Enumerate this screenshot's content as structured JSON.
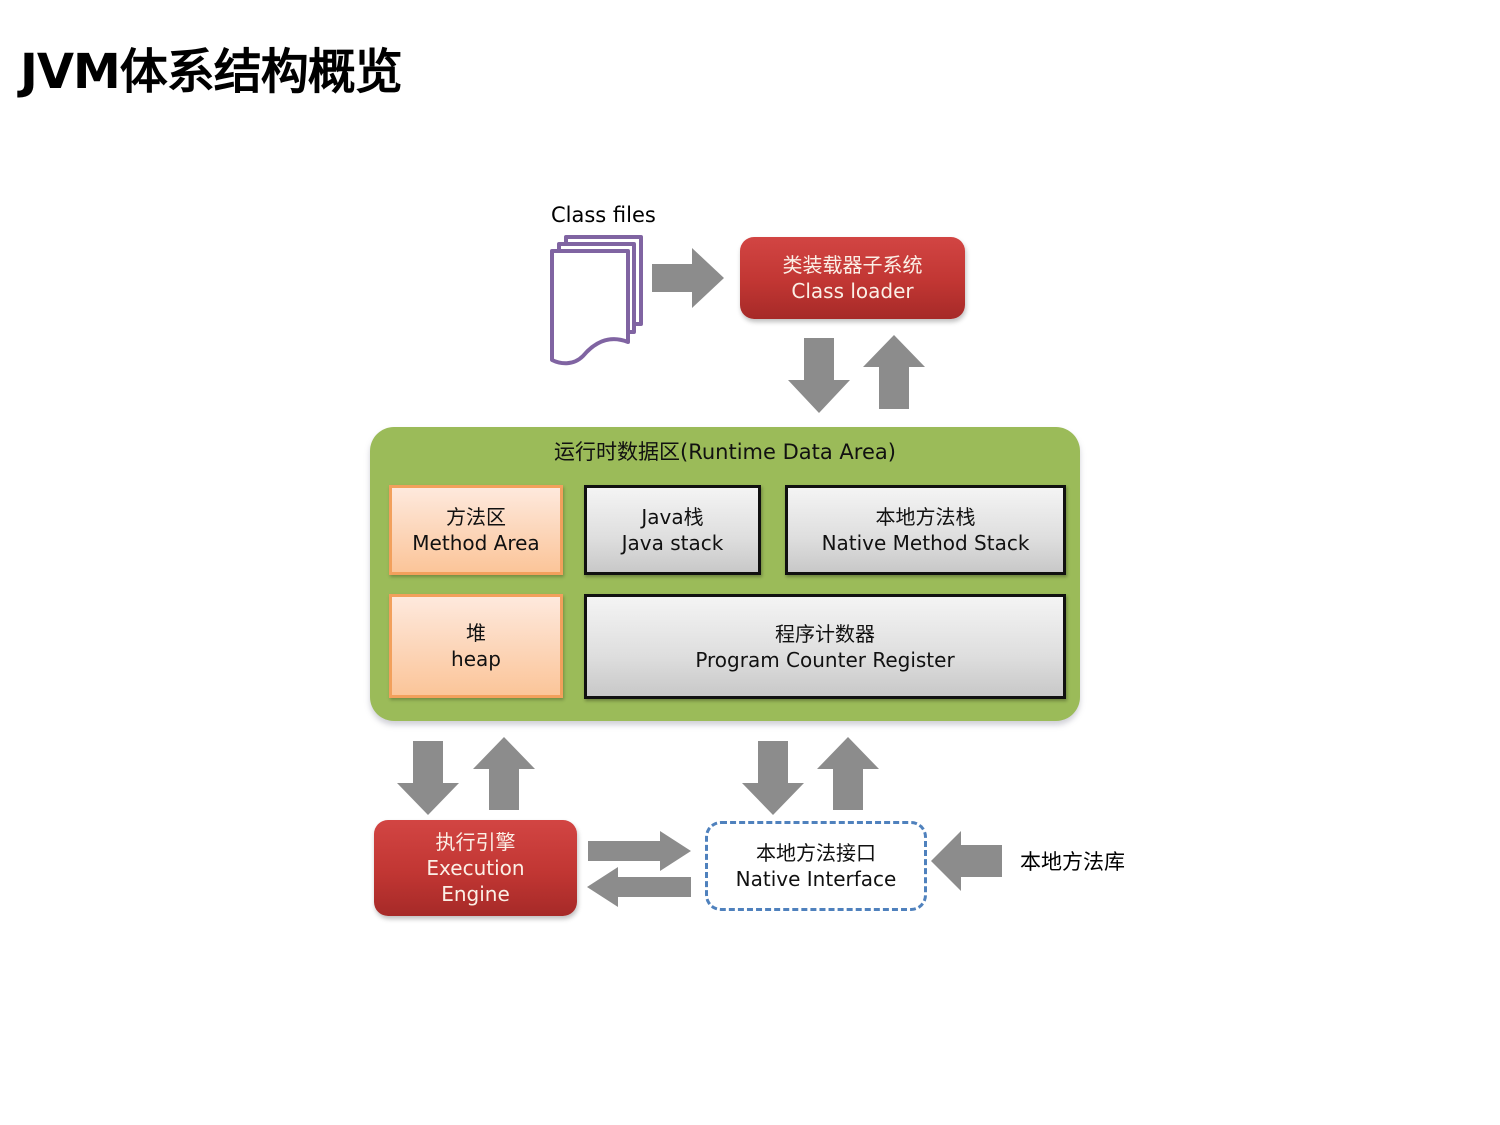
{
  "title": "JVM体系结构概览",
  "class_files": {
    "label": "Class files",
    "icon": "stacked-documents-icon",
    "icon_color": "#8064a2"
  },
  "class_loader": {
    "line1": "类装载器子系统",
    "line2": "Class loader"
  },
  "runtime_data_area": {
    "title": "运行时数据区(Runtime Data Area)",
    "color": "#9bbb59",
    "method_area": {
      "line1": "方法区",
      "line2": "Method Area"
    },
    "java_stack": {
      "line1": "Java栈",
      "line2": "Java stack"
    },
    "native_method_stack": {
      "line1": "本地方法栈",
      "line2": "Native Method Stack"
    },
    "heap": {
      "line1": "堆",
      "line2": "heap"
    },
    "program_counter": {
      "line1": "程序计数器",
      "line2": "Program Counter Register"
    }
  },
  "execution_engine": {
    "line1": "执行引擎",
    "line2": "Execution",
    "line3": "Engine"
  },
  "native_interface": {
    "line1": "本地方法接口",
    "line2": "Native Interface",
    "border_color": "#4f81bd"
  },
  "native_library": {
    "label": "本地方法库"
  },
  "colors": {
    "red_box": "#c0392b",
    "orange_box": "#fcd3b4",
    "gray_box": "#dedede",
    "arrow": "#8c8c8c"
  }
}
